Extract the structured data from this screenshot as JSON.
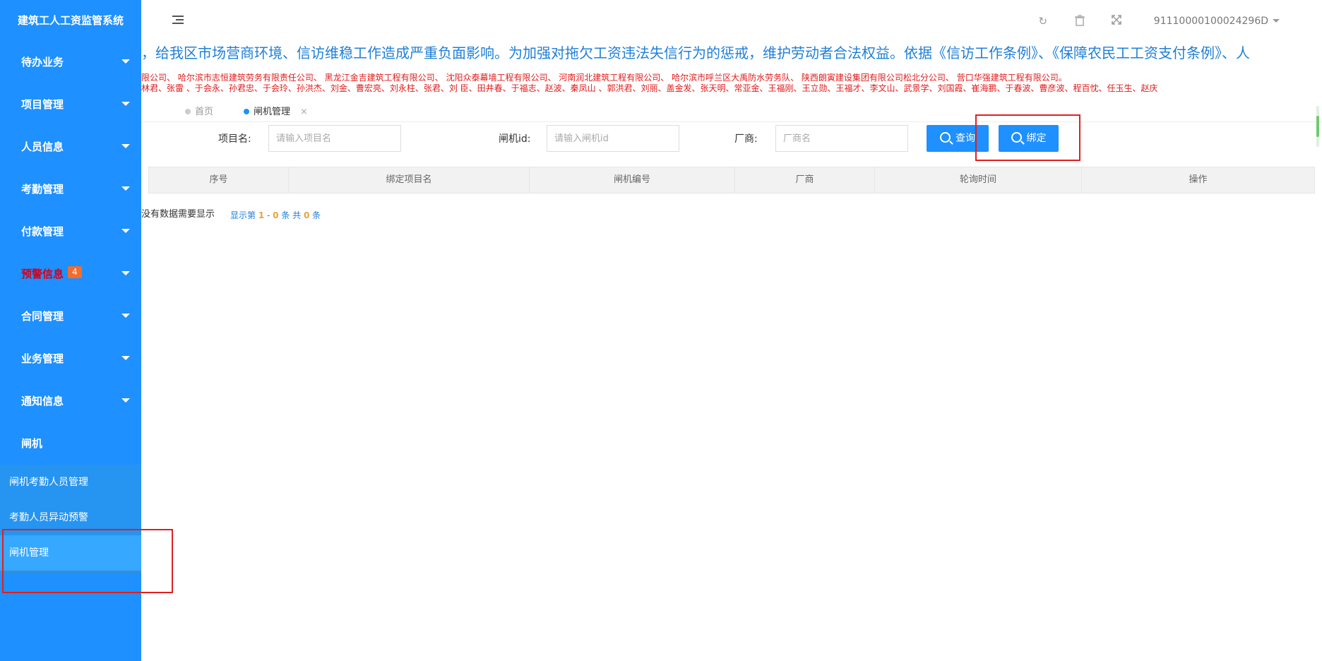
{
  "app": {
    "title": "建筑工人工资监管系统"
  },
  "sidebar": {
    "items": [
      {
        "label": "待办业务",
        "has_caret": true
      },
      {
        "label": "项目管理",
        "has_caret": true
      },
      {
        "label": "人员信息",
        "has_caret": true
      },
      {
        "label": "考勤管理",
        "has_caret": true
      },
      {
        "label": "付款管理",
        "has_caret": true
      },
      {
        "label": "预警信息",
        "has_caret": true,
        "badge": "4",
        "color": "#d4001a"
      },
      {
        "label": "合同管理",
        "has_caret": true
      },
      {
        "label": "业务管理",
        "has_caret": true
      },
      {
        "label": "通知信息",
        "has_caret": true
      },
      {
        "label": "闸机",
        "has_caret": false
      }
    ],
    "submenu": [
      {
        "label": "闸机考勤人员管理"
      },
      {
        "label": "考勤人员异动预警"
      },
      {
        "label": "闸机管理",
        "active": true
      }
    ]
  },
  "header": {
    "account": "91110000100024296D",
    "icons": [
      "refresh-icon",
      "trash-icon",
      "fullscreen-icon"
    ]
  },
  "marquee": {
    "line1": "，给我区市场营商环境、信访维稳工作造成严重负面影响。为加强对拖欠工资违法失信行为的惩戒，维护劳动者合法权益。依据《信访工作条例》、《保障农民工工资支付条例》、人",
    "line2": "限公司、 哈尔滨市志恒建筑劳务有限责任公司、 黑龙江金吉建筑工程有限公司、 沈阳众泰幕墙工程有限公司、 河南润北建筑工程有限公司、 哈尔滨市呼兰区大禹防水劳务队、 陕西朗寅建设集团有限公司松北分公司、 营口华强建筑工程有限公司。",
    "line3": "林君、张雷 、于会永、孙君忠、于会玲、孙洪杰、刘金、曹宏亮、刘永柱、张君、刘 臣、田井春、于福志、赵波、秦凤山 、郭洪君、刘丽、盖金发、张天明、常亚金、王福刚、王立勋、王福才、李文山、武景学、刘国霞、崔海鹏、于春波、曹彦波、程百忱、任玉生、赵庆"
  },
  "tabs": [
    {
      "label": "首页"
    },
    {
      "label": "闸机管理",
      "active": true
    }
  ],
  "form": {
    "project_label": "项目名:",
    "project_placeholder": "请输入项目名",
    "gate_label": "闸机id:",
    "gate_placeholder": "请输入闸机id",
    "vendor_label": "厂商:",
    "vendor_placeholder": "厂商名",
    "query_button": "查询",
    "bind_button": "绑定"
  },
  "table": {
    "columns": [
      "序号",
      "绑定项目名",
      "闸机编号",
      "厂商",
      "轮询时间",
      "操作"
    ],
    "rows": [],
    "empty_text": "没有数据需要显示"
  },
  "pager": {
    "prefix": "显示第 ",
    "from": "1",
    "dash": " - ",
    "to": "0",
    "middle": " 条 共 ",
    "total": "0",
    "suffix": " 条"
  },
  "colors": {
    "sidebar_bg": "#1e90ff",
    "accent": "#1e90ff",
    "highlight": "#e02020",
    "marquee_blue": "#1e7fd8",
    "marquee_red": "#e21b1b"
  }
}
